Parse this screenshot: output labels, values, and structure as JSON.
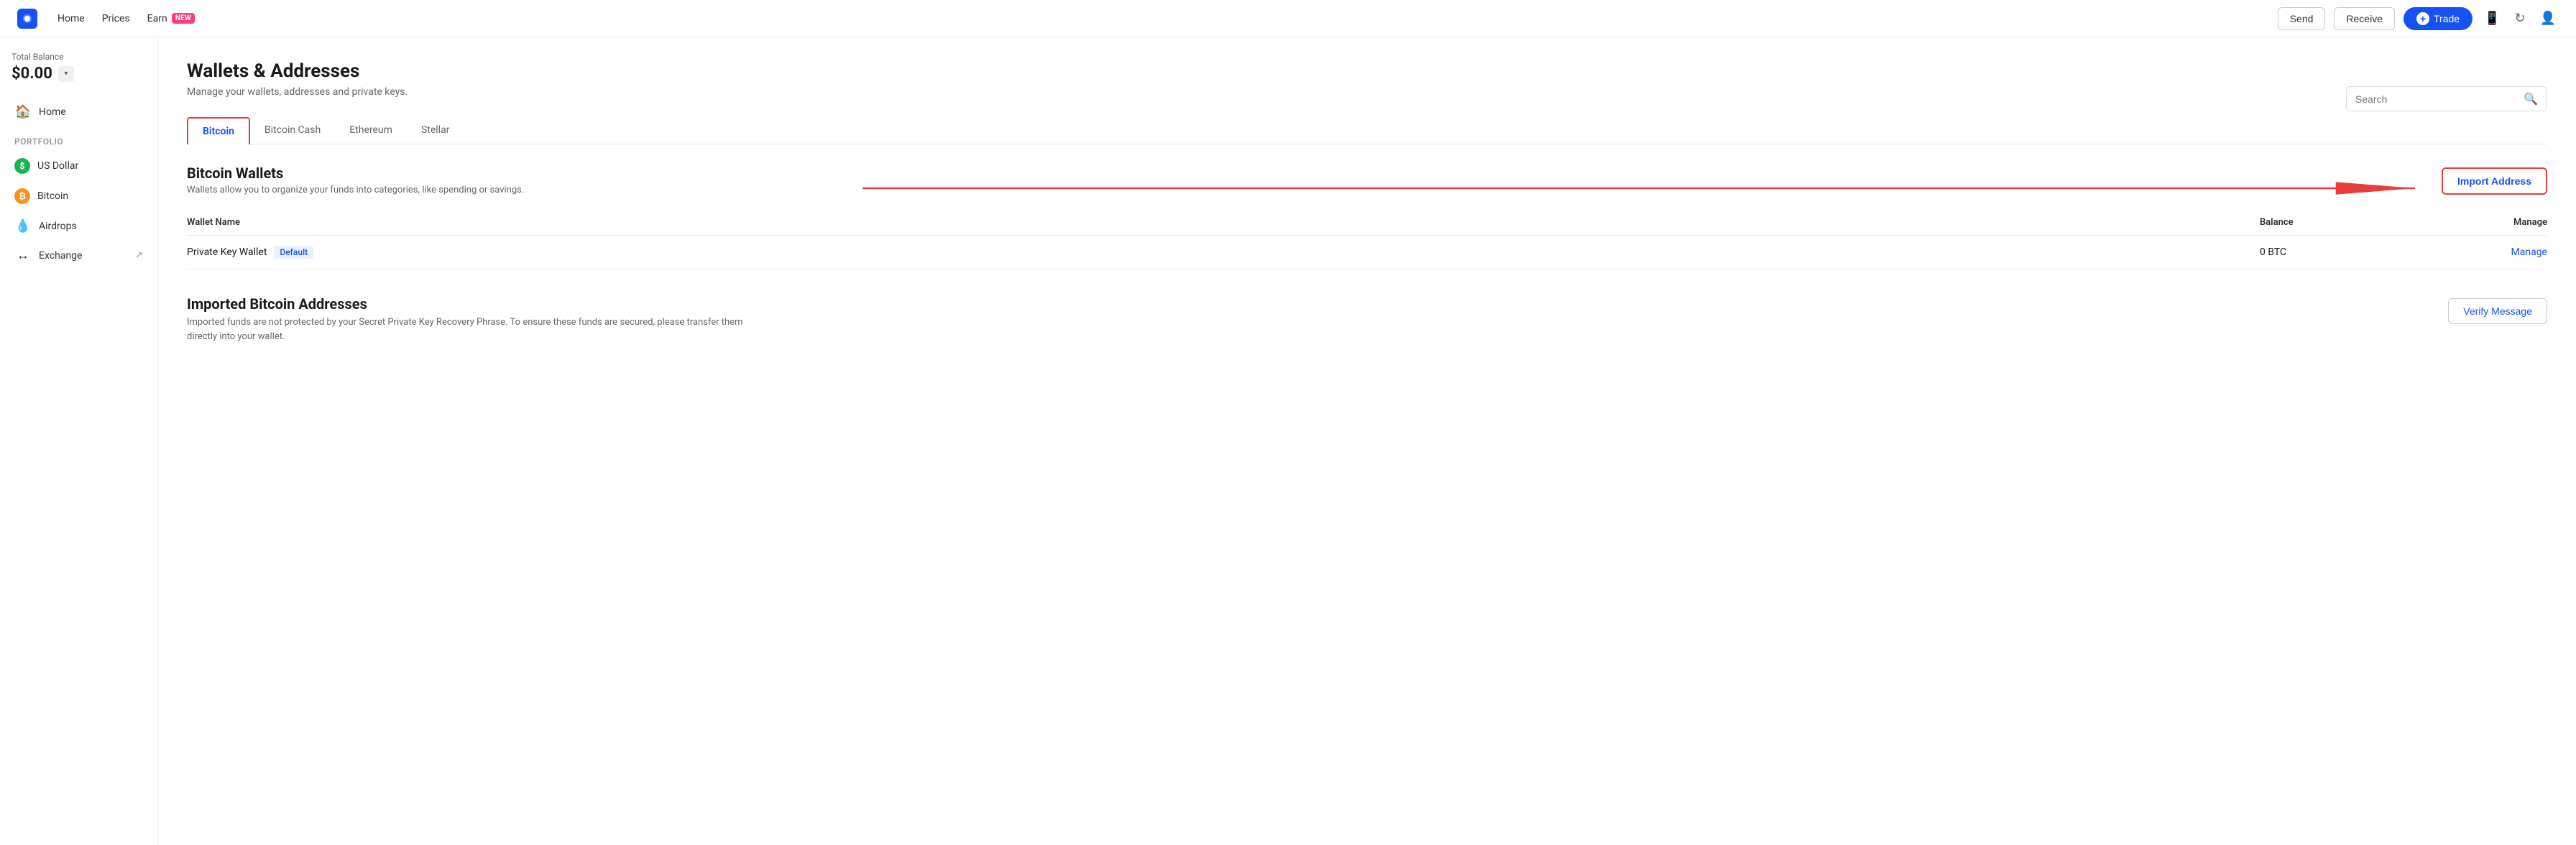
{
  "topNav": {
    "links": [
      {
        "id": "home",
        "label": "Home"
      },
      {
        "id": "prices",
        "label": "Prices"
      },
      {
        "id": "earn",
        "label": "Earn",
        "badge": "NEW"
      }
    ],
    "send_label": "Send",
    "receive_label": "Receive",
    "trade_label": "Trade",
    "trade_plus": "+"
  },
  "sidebar": {
    "balance_label": "Total Balance",
    "balance_amount": "$0.00",
    "nav_items": [
      {
        "id": "home",
        "icon": "🏠",
        "label": "Home"
      }
    ],
    "portfolio_label": "Portfolio",
    "portfolio_items": [
      {
        "id": "us-dollar",
        "icon": "$",
        "label": "US Dollar",
        "type": "usd"
      },
      {
        "id": "bitcoin",
        "icon": "₿",
        "label": "Bitcoin",
        "type": "btc"
      }
    ],
    "other_items": [
      {
        "id": "airdrops",
        "icon": "💧",
        "label": "Airdrops"
      },
      {
        "id": "exchange",
        "icon": "↔",
        "label": "Exchange",
        "external": true
      }
    ]
  },
  "main": {
    "page_title": "Wallets & Addresses",
    "page_subtitle": "Manage your wallets, addresses and private keys.",
    "tabs": [
      {
        "id": "bitcoin",
        "label": "Bitcoin",
        "active": true
      },
      {
        "id": "bitcoin-cash",
        "label": "Bitcoin Cash"
      },
      {
        "id": "ethereum",
        "label": "Ethereum"
      },
      {
        "id": "stellar",
        "label": "Stellar"
      }
    ],
    "search_placeholder": "Search",
    "wallets_section": {
      "title": "Bitcoin Wallets",
      "description": "Wallets allow you to organize your funds into categories, like spending or savings.",
      "import_button": "Import Address",
      "table_headers": {
        "name": "Wallet Name",
        "balance": "Balance",
        "manage": "Manage"
      },
      "rows": [
        {
          "name": "Private Key Wallet",
          "badge": "Default",
          "balance": "0 BTC",
          "manage_label": "Manage"
        }
      ]
    },
    "imported_section": {
      "title": "Imported Bitcoin Addresses",
      "description": "Imported funds are not protected by your Secret Private Key Recovery Phrase. To ensure these funds are secured, please transfer them directly into your wallet.",
      "verify_button": "Verify Message"
    }
  }
}
